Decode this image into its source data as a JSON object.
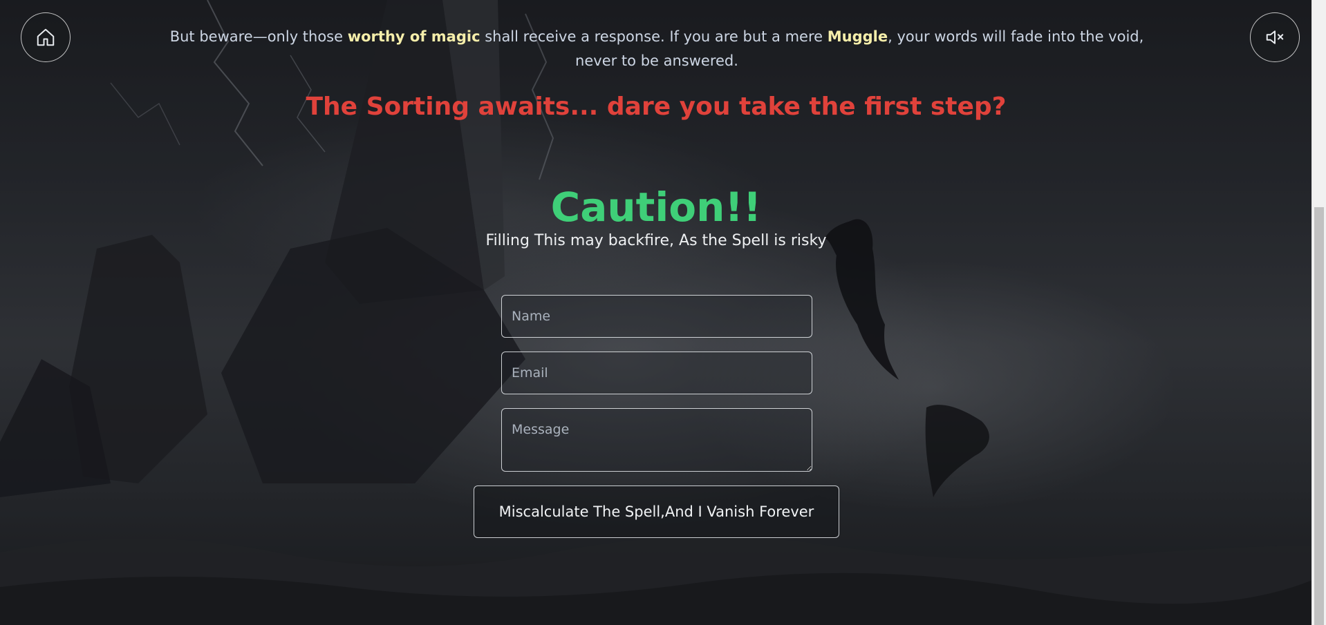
{
  "header": {
    "home_icon": "home-icon",
    "mute_icon": "volume-mute-icon"
  },
  "intro": {
    "part1": "But beware—only those ",
    "highlight1": "worthy of magic",
    "part2": " shall receive a response. If you are but a mere ",
    "highlight2": "Muggle",
    "part3": ", your words will fade into the void, never to be answered."
  },
  "sorting_heading": "The Sorting awaits... dare you take the first step?",
  "caution": {
    "title": "Caution!!",
    "subtitle": "Filling This may backfire, As the Spell is risky"
  },
  "form": {
    "name_placeholder": "Name",
    "email_placeholder": "Email",
    "message_placeholder": "Message",
    "submit_label": "Miscalculate The Spell,And I Vanish Forever"
  },
  "colors": {
    "sorting_red": "#e0423b",
    "caution_green": "#3fcf78",
    "highlight_yellow": "#f5eeaa"
  }
}
